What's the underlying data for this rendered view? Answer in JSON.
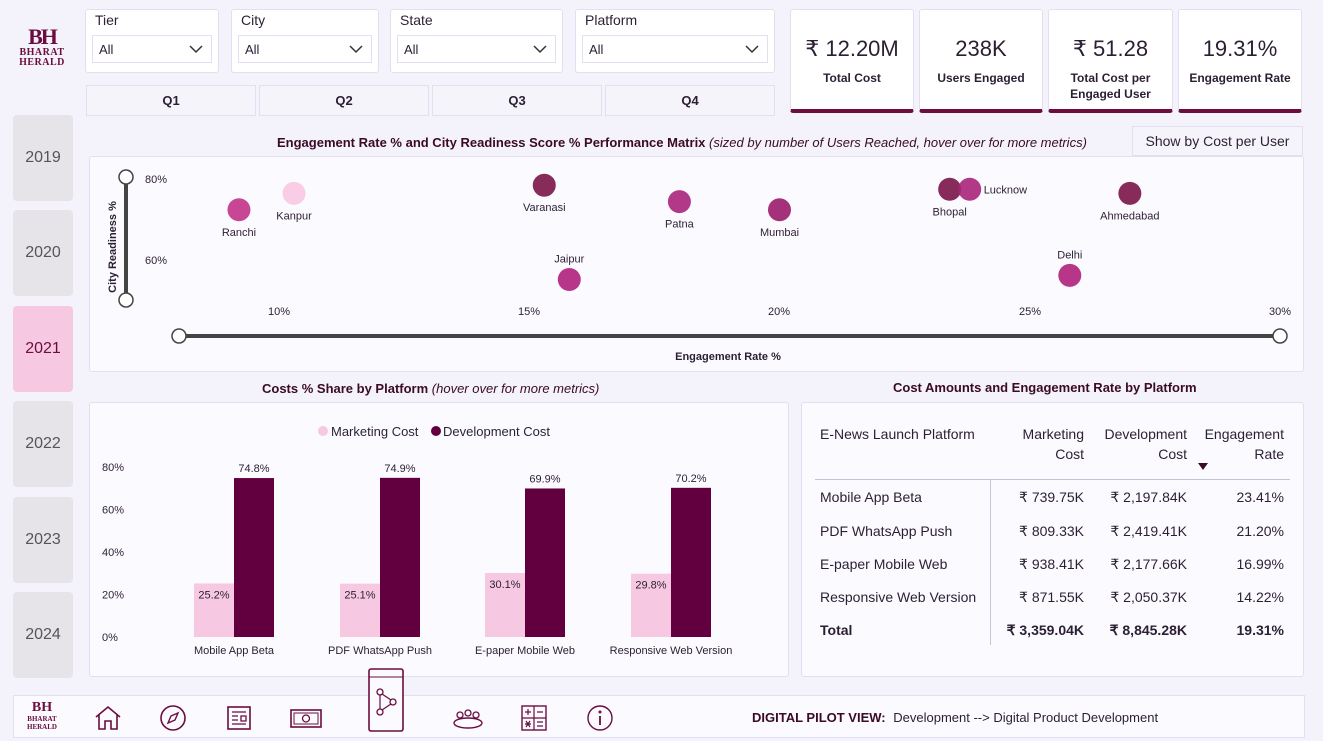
{
  "logo": {
    "mark": "BH",
    "line1": "BHARAT",
    "line2": "HERALD"
  },
  "slicers": [
    {
      "label": "Tier",
      "value": "All"
    },
    {
      "label": "City",
      "value": "All"
    },
    {
      "label": "State",
      "value": "All"
    },
    {
      "label": "Platform",
      "value": "All"
    }
  ],
  "quarters": [
    "Q1",
    "Q2",
    "Q3",
    "Q4"
  ],
  "kpis": [
    {
      "value": "₹ 12.20M",
      "caption": "Total Cost"
    },
    {
      "value": "238K",
      "caption": "Users Engaged"
    },
    {
      "value": "₹ 51.28",
      "caption": "Total Cost per Engaged User"
    },
    {
      "value": "19.31%",
      "caption": "Engagement Rate"
    }
  ],
  "years": [
    "2019",
    "2020",
    "2021",
    "2022",
    "2023",
    "2024"
  ],
  "selected_year": "2021",
  "matrix": {
    "title": "Engagement Rate % and City Readiness Score % Performance Matrix",
    "subtitle": "(sized by number of Users Reached, hover over for more metrics)",
    "toggle_label": "Show by Cost per User",
    "ylabel": "City Readiness %",
    "xlabel": "Engagement Rate %",
    "y_ticks": [
      "80%",
      "60%"
    ],
    "x_ticks": [
      "10%",
      "15%",
      "20%",
      "25%",
      "30%"
    ]
  },
  "colors": {
    "accent": "#6b0d3f",
    "pink": "#f7c8e2",
    "magenta": "#a8237a"
  },
  "chart_data": [
    {
      "type": "scatter",
      "title": "Engagement Rate % and City Readiness Score % Performance Matrix",
      "xlabel": "Engagement Rate %",
      "ylabel": "City Readiness %",
      "points": [
        {
          "label": "Ranchi",
          "x": 9.2,
          "y": 72,
          "color": "#c2338a"
        },
        {
          "label": "Kanpur",
          "x": 10.3,
          "y": 76,
          "color": "#f7c8e2"
        },
        {
          "label": "Varanasi",
          "x": 15.3,
          "y": 78,
          "color": "#7a1548"
        },
        {
          "label": "Jaipur",
          "x": 15.8,
          "y": 55,
          "color": "#b0207c"
        },
        {
          "label": "Patna",
          "x": 18.0,
          "y": 74,
          "color": "#a8237a"
        },
        {
          "label": "Mumbai",
          "x": 20.0,
          "y": 72,
          "color": "#9b1b6c"
        },
        {
          "label": "Bhopal",
          "x": 23.4,
          "y": 77,
          "color": "#7a1548"
        },
        {
          "label": "Lucknow",
          "x": 23.8,
          "y": 77,
          "color": "#a8237a"
        },
        {
          "label": "Delhi",
          "x": 25.8,
          "y": 56,
          "color": "#b0207c"
        },
        {
          "label": "Ahmedabad",
          "x": 27.0,
          "y": 76,
          "color": "#7a1548"
        }
      ]
    },
    {
      "type": "bar",
      "title": "Costs % Share by Platform",
      "subtitle": "(hover over for more metrics)",
      "categories": [
        "Mobile App Beta",
        "PDF WhatsApp Push",
        "E-paper Mobile Web",
        "Responsive Web Version"
      ],
      "series": [
        {
          "name": "Marketing Cost",
          "values": [
            25.2,
            25.1,
            30.1,
            29.8
          ],
          "color": "#f7c8e2"
        },
        {
          "name": "Development Cost",
          "values": [
            74.8,
            74.9,
            69.9,
            70.2
          ],
          "color": "#62003f"
        }
      ],
      "y_ticks": [
        "80%",
        "60%",
        "40%",
        "20%",
        "0%"
      ],
      "ylim": [
        0,
        80
      ]
    }
  ],
  "table": {
    "title": "Cost Amounts and Engagement Rate by Platform",
    "headers": {
      "platform": "E-News Launch Platform",
      "marketing_l1": "Marketing",
      "marketing_l2": "Cost",
      "development_l1": "Development",
      "development_l2": "Cost",
      "engagement_l1": "Engagement",
      "engagement_l2": "Rate"
    },
    "rows": [
      {
        "platform": "Mobile App Beta",
        "marketing": "₹ 739.75K",
        "development": "₹ 2,197.84K",
        "engagement": "23.41%"
      },
      {
        "platform": "PDF WhatsApp Push",
        "marketing": "₹ 809.33K",
        "development": "₹ 2,419.41K",
        "engagement": "21.20%"
      },
      {
        "platform": "E-paper Mobile Web",
        "marketing": "₹ 938.41K",
        "development": "₹ 2,177.66K",
        "engagement": "16.99%"
      },
      {
        "platform": "Responsive Web Version",
        "marketing": "₹ 871.55K",
        "development": "₹ 2,050.37K",
        "engagement": "14.22%"
      }
    ],
    "total": {
      "label": "Total",
      "marketing": "₹ 3,359.04K",
      "development": "₹ 8,845.28K",
      "engagement": "19.31%"
    }
  },
  "footer": {
    "view_label": "DIGITAL PILOT VIEW:",
    "view_value": "Development --> Digital Product Development",
    "icons": [
      "home-icon",
      "compass-icon",
      "newspaper-icon",
      "money-icon",
      "digital-network-icon",
      "people-icon",
      "calculator-icon",
      "info-icon"
    ]
  }
}
